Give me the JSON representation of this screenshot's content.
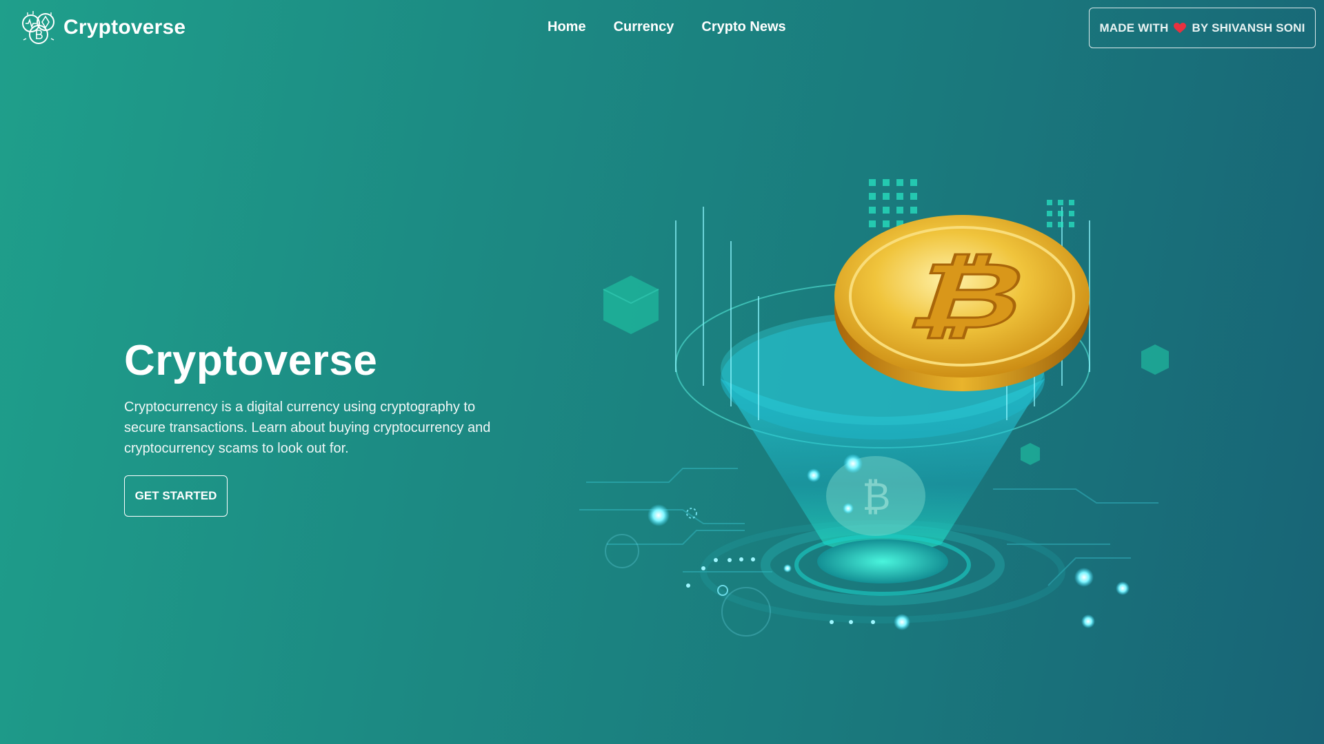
{
  "brand": {
    "name": "Cryptoverse",
    "logo_icon": "crypto-coins-logo-icon"
  },
  "nav": {
    "items": [
      {
        "label": "Home"
      },
      {
        "label": "Currency"
      },
      {
        "label": "Crypto News"
      }
    ]
  },
  "credit": {
    "prefix": "MADE WITH",
    "icon": "heart-icon",
    "suffix": "BY SHIVANSH SONI"
  },
  "hero": {
    "title": "Cryptoverse",
    "description": "Cryptocurrency is a digital currency using cryptography to secure transactions. Learn about buying cryptocurrency and cryptocurrency scams to look out for.",
    "cta_label": "GET STARTED",
    "illustration_icon": "bitcoin-coin-illustration"
  },
  "colors": {
    "background_start": "#1f9f8b",
    "background_end": "#186476",
    "coin_gold": "#e8b22a",
    "glow_cyan": "#3ef0e0",
    "heart": "#e8313f"
  }
}
